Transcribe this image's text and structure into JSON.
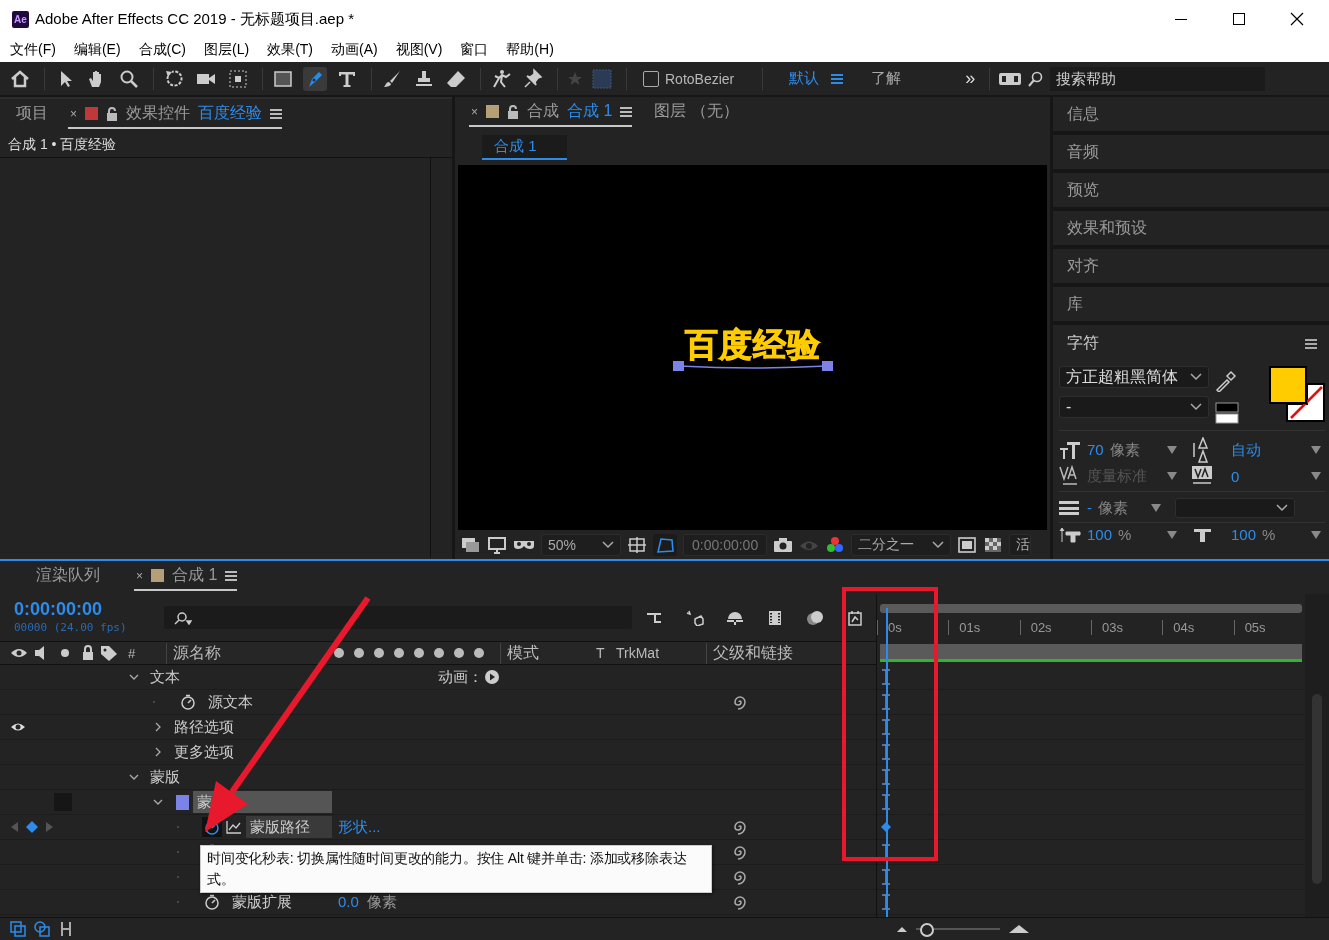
{
  "window": {
    "title": "Adobe After Effects CC 2019 - 无标题项目.aep *",
    "app_badge": "Ae"
  },
  "menu": [
    "文件(F)",
    "编辑(E)",
    "合成(C)",
    "图层(L)",
    "效果(T)",
    "动画(A)",
    "视图(V)",
    "窗口",
    "帮助(H)"
  ],
  "toolbar": {
    "tools": [
      {
        "selected": false
      },
      {
        "selected": false
      },
      {
        "selected": false
      },
      {
        "selected": false
      },
      {
        "selected": false
      },
      {
        "selected": false
      },
      {
        "selected": false
      },
      {
        "selected": false
      },
      {
        "selected": true
      },
      {
        "selected": false
      },
      {
        "selected": false
      },
      {
        "selected": false
      },
      {
        "selected": false
      },
      {
        "selected": false
      },
      {
        "selected": false
      }
    ],
    "rotobezier": {
      "label": "RotoBezier",
      "checked": false
    },
    "workspaces": [
      {
        "label": "默认",
        "selected": true
      },
      {
        "label": "了解",
        "selected": false
      }
    ],
    "overflow": "»",
    "search": {
      "placeholder": "搜索帮助"
    }
  },
  "project_panel": {
    "tabs": [
      {
        "label": "项目",
        "selected": false
      },
      {
        "label": "效果控件",
        "target": "百度经验",
        "selected": true,
        "close": "×",
        "color": "#c0383a"
      }
    ],
    "breadcrumb": "合成 1 • 百度经验"
  },
  "comp_panel": {
    "tabs": [
      {
        "label": "合成",
        "target": "合成 1",
        "selected": true,
        "close": "×",
        "color": "#b59f78"
      },
      {
        "label": "图层 （无）",
        "selected": false
      }
    ],
    "view_tab": "合成 1",
    "viewer_text": "百度经验",
    "zoom": "50%",
    "timecode": "0:00:00:00",
    "resolution": "二分之一",
    "camera": "活"
  },
  "side_panels": [
    "信息",
    "音频",
    "预览",
    "效果和预设",
    "对齐",
    "库"
  ],
  "character": {
    "title": "字符",
    "font": "方正超粗黑简体",
    "style": "-",
    "fill": {
      "color": "#ffcc00"
    },
    "size": {
      "value": "70",
      "unit": "像素"
    },
    "leading": "自动",
    "kerning": "度量标准",
    "tracking": "0",
    "stroke": {
      "value": "-",
      "unit": "像素"
    },
    "vertical_scale": {
      "value": "100",
      "unit": "%"
    },
    "horizontal_scale": {
      "value": "100",
      "unit": "%"
    }
  },
  "timeline": {
    "tabs": [
      {
        "label": "渲染队列",
        "selected": false
      },
      {
        "label": "合成 1",
        "selected": true,
        "close": "×",
        "color": "#b59f78"
      }
    ],
    "timecode": "0:00:00:00",
    "frame_info": "00000 (24.00 fps)",
    "columns": [
      "#",
      "源名称",
      "模式",
      "T",
      "TrkMat",
      "父级和链接"
    ],
    "ruler": [
      "0s",
      "01s",
      "02s",
      "03s",
      "04s",
      "05s"
    ],
    "rows": [
      {
        "kind": "group",
        "label": "文本",
        "expanded": true,
        "visible": false,
        "action": "动画：",
        "children": [
          {
            "kind": "property",
            "label": "源文本",
            "visible": false,
            "stopwatch": false,
            "keyframe": false
          },
          {
            "kind": "group",
            "label": "路径选项",
            "expanded": false,
            "visible": true
          },
          {
            "kind": "group",
            "label": "更多选项",
            "expanded": false,
            "visible": false
          }
        ]
      },
      {
        "kind": "group",
        "label": "蒙版",
        "expanded": true,
        "visible": false,
        "children": [
          {
            "kind": "mask",
            "label": "蒙",
            "expanded": true,
            "visible": false,
            "color": "#7b83e6",
            "children": [
              {
                "kind": "property",
                "label": "蒙版路径",
                "value": "形状...",
                "visible": false,
                "stopwatch": true,
                "keyframe": true
              },
              {
                "kind": "property",
                "visible": false,
                "stopwatch": false,
                "keyframe": false
              },
              {
                "kind": "property",
                "visible": false,
                "stopwatch": false,
                "keyframe": false
              },
              {
                "kind": "property",
                "label": "蒙版扩展",
                "value": "0.0",
                "unit": "像素",
                "visible": false,
                "stopwatch": false,
                "keyframe": false
              }
            ]
          }
        ]
      }
    ],
    "zoom": {
      "level": 0.05
    },
    "tooltip": "时间变化秒表: 切换属性随时间更改的能力。按住 Alt 键并单击: 添加或移除表达式。"
  }
}
